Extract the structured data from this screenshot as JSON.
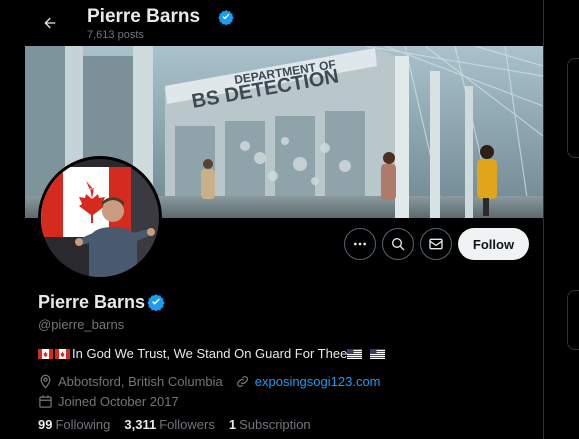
{
  "header": {
    "name": "Pierre Barns",
    "posts": "7,613 posts"
  },
  "banner": {
    "sign_line1": "DEPARTMENT OF",
    "sign_line2": "BS DETECTION"
  },
  "actions": {
    "follow_label": "Follow"
  },
  "profile": {
    "name": "Pierre Barns",
    "handle": "@pierre_barns",
    "bio": "In God We Trust, We Stand On Guard For Thee",
    "location": "Abbotsford, British Columbia",
    "website": "exposingsogi123.com",
    "joined": "Joined October 2017"
  },
  "stats": {
    "following_count": "99",
    "following_label": "Following",
    "followers_count": "3,311",
    "followers_label": "Followers",
    "subscription_count": "1",
    "subscription_label": "Subscription"
  },
  "colors": {
    "verified": "#1d9bf0",
    "link": "#1d9bf0",
    "muted": "#71767b",
    "follow_bg": "#eff3f4"
  },
  "icons": [
    "back-arrow-icon",
    "verified-badge-icon",
    "more-icon",
    "search-icon",
    "message-icon",
    "location-icon",
    "link-icon",
    "calendar-icon"
  ]
}
